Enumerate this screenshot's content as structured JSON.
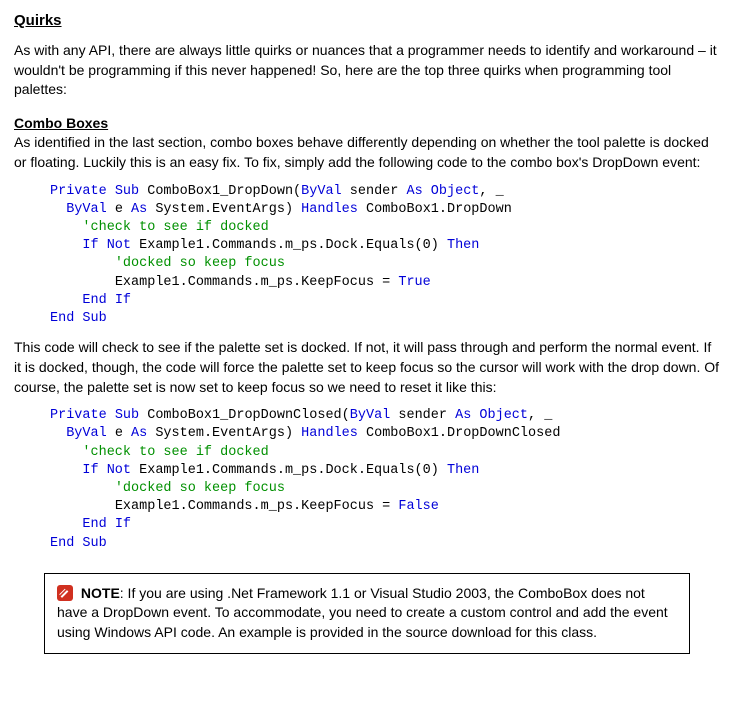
{
  "heading": "Quirks",
  "intro": "As with any API, there are always little quirks or nuances that a programmer needs to identify and workaround – it wouldn't be programming if this never happened! So, here are the top three quirks when programming tool palettes:",
  "subheading": "Combo Boxes",
  "combo_intro": "As identified in the last section, combo boxes behave differently depending on whether the tool palette is docked or floating. Luckily this is an easy fix. To fix, simply add the following code to the combo box's DropDown event:",
  "code1": {
    "l1a": "Private",
    "l1b": " Sub",
    "l1c": " ComboBox1_DropDown(",
    "l1d": "ByVal",
    "l1e": " sender ",
    "l1f": "As",
    "l1g": " Object",
    "l1h": ", _",
    "l2a": "ByVal",
    "l2b": " e ",
    "l2c": "As",
    "l2d": " System.EventArgs) ",
    "l2e": "Handles",
    "l2f": " ComboBox1.DropDown",
    "l3": "'check to see if docked",
    "l4a": "If",
    "l4b": " Not",
    "l4c": " Example1.Commands.m_ps.Dock.Equals(0) ",
    "l4d": "Then",
    "l5": "'docked so keep focus",
    "l6a": "Example1.Commands.m_ps.KeepFocus = ",
    "l6b": "True",
    "l7a": "End",
    "l7b": " If",
    "l8a": "End",
    "l8b": " Sub"
  },
  "mid_para": "This code will check to see if the palette set is docked. If not, it will pass through and perform the normal event. If it is docked, though, the code will force the palette set to keep focus so the cursor will work with the drop down. Of course, the palette set is now set to keep focus so we need to reset it like this:",
  "code2": {
    "l1a": "Private",
    "l1b": " Sub",
    "l1c": " ComboBox1_DropDownClosed(",
    "l1d": "ByVal",
    "l1e": " sender ",
    "l1f": "As",
    "l1g": " Object",
    "l1h": ", _",
    "l2a": "ByVal",
    "l2b": " e ",
    "l2c": "As",
    "l2d": " System.EventArgs) ",
    "l2e": "Handles",
    "l2f": " ComboBox1.DropDownClosed",
    "l3": "'check to see if docked",
    "l4a": "If",
    "l4b": " Not",
    "l4c": " Example1.Commands.m_ps.Dock.Equals(0) ",
    "l4d": "Then",
    "l5": "'docked so keep focus",
    "l6a": "Example1.Commands.m_ps.KeepFocus = ",
    "l6b": "False",
    "l7a": "End",
    "l7b": " If",
    "l8a": "End",
    "l8b": " Sub"
  },
  "note_label": "NOTE",
  "note_text": ": If you are using .Net Framework 1.1 or Visual Studio 2003, the ComboBox does not have a DropDown event. To accommodate, you need to create a custom control and add the event using Windows API code. An example is provided in the source download for this class."
}
